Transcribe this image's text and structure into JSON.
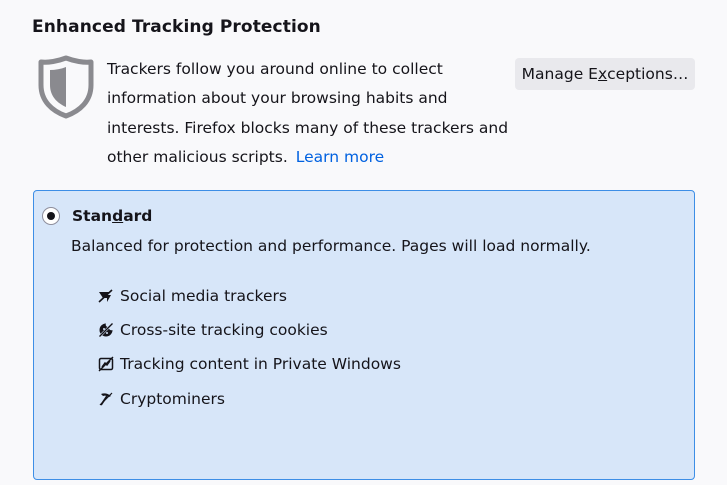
{
  "section": {
    "title": "Enhanced Tracking Protection"
  },
  "intro": {
    "description": "Trackers follow you around online to collect information about your browsing habits and interests. Firefox blocks many of these trackers and other malicious scripts.",
    "learn_more": "Learn more"
  },
  "manage_exceptions": {
    "label_pre": "Manage E",
    "label_mnemonic": "x",
    "label_post": "ceptions…"
  },
  "standard": {
    "label_pre": "Stan",
    "label_mnemonic": "d",
    "label_post": "ard",
    "selected": true,
    "description": "Balanced for protection and performance. Pages will load normally.",
    "blocked_items": [
      {
        "label": "Social media trackers",
        "icon": "social-media-tracker-icon"
      },
      {
        "label": "Cross-site tracking cookies",
        "icon": "cookie-icon"
      },
      {
        "label": "Tracking content in Private Windows",
        "icon": "tracking-content-icon"
      },
      {
        "label": "Cryptominers",
        "icon": "cryptominer-icon"
      }
    ]
  },
  "colors": {
    "accent": "#0061e0",
    "selected_box_bg": "#d7e6f9",
    "selected_box_border": "#3d8ee6",
    "button_bg": "#e9e9ed"
  }
}
